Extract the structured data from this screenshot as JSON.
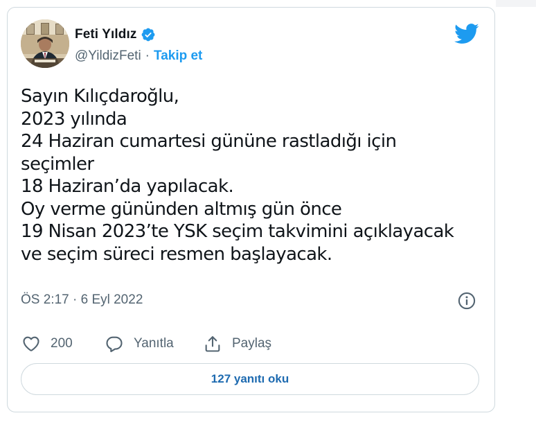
{
  "author": {
    "name": "Feti Yıldız",
    "handle": "@YildizFeti",
    "separator": "·",
    "follow_label": "Takip et"
  },
  "tweet": {
    "text": "Sayın Kılıçdaroğlu,\n2023 yılında\n24 Haziran cumartesi gününe rastladığı için\nseçimler\n18 Haziran’da yapılacak.\nOy verme gününden altmış gün önce\n19 Nisan 2023’te YSK seçim takvimini açıklayacak\nve seçim süreci resmen başlayacak.",
    "timestamp": "ÖS 2:17 · 6 Eyl 2022"
  },
  "actions": {
    "like_count": "200",
    "reply_label": "Yanıtla",
    "share_label": "Paylaş"
  },
  "replies_button_label": "127 yanıtı oku",
  "icons": {
    "verified": "verified-badge-icon",
    "brand": "twitter-bird-icon",
    "info": "info-icon",
    "like": "heart-icon",
    "reply": "speech-bubble-icon",
    "share": "share-icon"
  },
  "colors": {
    "brand_blue": "#1d9bf0",
    "text_primary": "#0f1419",
    "text_secondary": "#536471",
    "border": "#cfd9de",
    "link_dark_blue": "#1d6ab0"
  }
}
